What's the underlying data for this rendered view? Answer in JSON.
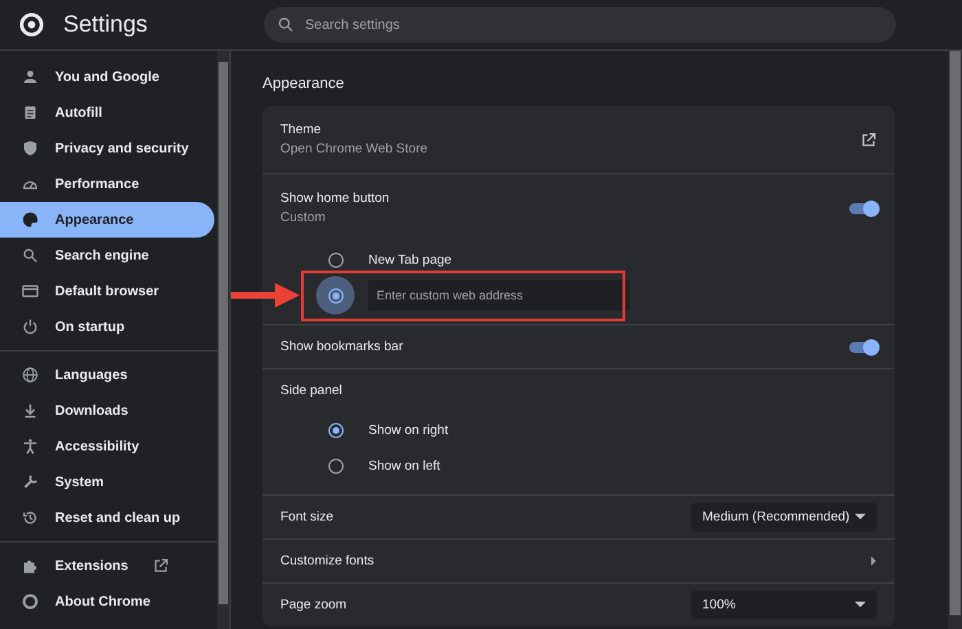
{
  "header": {
    "title": "Settings",
    "search": {
      "placeholder": "Search settings"
    }
  },
  "sidebar": {
    "groups": [
      [
        {
          "label": "You and Google",
          "selected": false
        },
        {
          "label": "Autofill",
          "selected": false
        },
        {
          "label": "Privacy and security",
          "selected": false
        },
        {
          "label": "Performance",
          "selected": false
        },
        {
          "label": "Appearance",
          "selected": true
        },
        {
          "label": "Search engine",
          "selected": false
        },
        {
          "label": "Default browser",
          "selected": false
        },
        {
          "label": "On startup",
          "selected": false
        }
      ],
      [
        {
          "label": "Languages",
          "selected": false
        },
        {
          "label": "Downloads",
          "selected": false
        },
        {
          "label": "Accessibility",
          "selected": false
        },
        {
          "label": "System",
          "selected": false
        },
        {
          "label": "Reset and clean up",
          "selected": false
        }
      ],
      [
        {
          "label": "Extensions",
          "selected": false,
          "external": true
        },
        {
          "label": "About Chrome",
          "selected": false,
          "external": false
        }
      ]
    ]
  },
  "section": {
    "title": "Appearance",
    "rows": [
      {
        "kind": "link",
        "title": "Theme",
        "subtitle": "Open Chrome Web Store"
      },
      {
        "kind": "toggle",
        "title": "Show home button",
        "subtitle": "Custom",
        "on": true,
        "options": [
          {
            "label": "New Tab page",
            "selected": false
          },
          {
            "placeholder": "Enter custom web address",
            "selected": true
          }
        ]
      },
      {
        "kind": "toggle",
        "title": "Show bookmarks bar",
        "on": true
      },
      {
        "kind": "radio-group",
        "title": "Side panel",
        "options": [
          {
            "label": "Show on right",
            "selected": true
          },
          {
            "label": "Show on left",
            "selected": false
          }
        ]
      },
      {
        "kind": "select",
        "title": "Font size",
        "value": "Medium (Recommended)"
      },
      {
        "kind": "submenu",
        "title": "Customize fonts"
      },
      {
        "kind": "select",
        "title": "Page zoom",
        "value": "100%"
      }
    ]
  }
}
